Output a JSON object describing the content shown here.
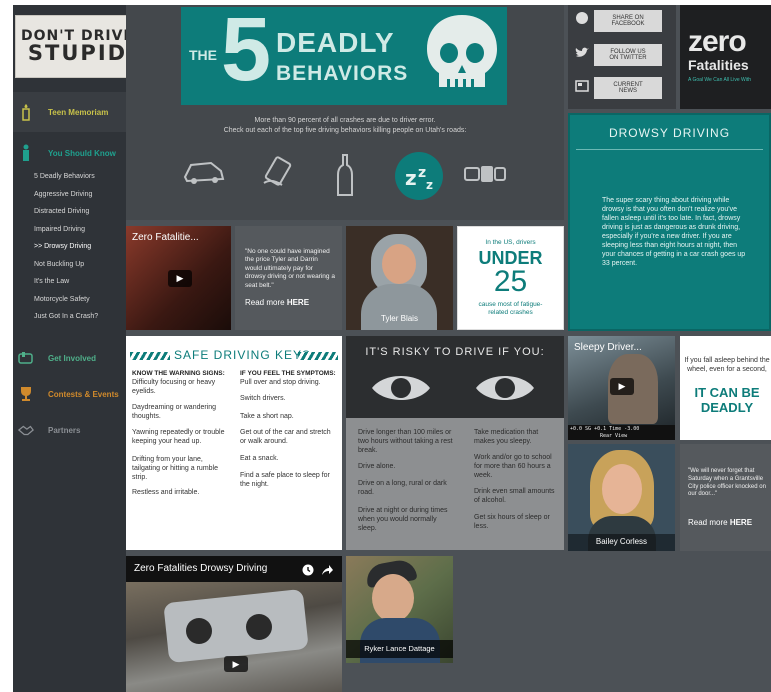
{
  "logo": {
    "line1": "DON'T DRIVE",
    "line2": "STUPID"
  },
  "nav": {
    "teen_memoriam": "Teen Memoriam",
    "you_should_know": "You Should Know",
    "sub_items": [
      "5 Deadly Behaviors",
      "Aggressive Driving",
      "Distracted Driving",
      "Impaired Driving",
      ">> Drowsy Driving",
      "Not Buckling Up",
      "It's the Law",
      "Motorcycle Safety",
      "Just Got In a Crash?"
    ],
    "get_involved": "Get Involved",
    "contests": "Contests & Events",
    "partners": "Partners"
  },
  "hero": {
    "the": "THE",
    "five": "5",
    "deadly": "DEADLY",
    "behaviors": "BEHAVIORS",
    "caption1": "More than 90 percent of all crashes are due to driver error.",
    "caption2": "Check out each of the top five driving behaviors killing people on Utah's roads:"
  },
  "social": {
    "facebook": [
      "SHARE ON",
      "FACEBOOK"
    ],
    "twitter": [
      "FOLLOW US",
      "ON TWITTER"
    ],
    "news": [
      "CURRENT",
      "NEWS"
    ]
  },
  "zero_banner": {
    "zero": "zero",
    "fatalities": "Fatalities",
    "tagline": "A Goal We Can All Live With"
  },
  "drowsy": {
    "title": "DROWSY DRIVING",
    "body": "The super scary thing about driving while drowsy is that you often don't realize you've fallen asleep until it's too late. In fact, drowsy driving is just as dangerous as drunk driving, especially if you're a new driver. If you are sleeping less than eight hours at night, then your chances of getting in a car crash goes up 33 percent."
  },
  "video1": {
    "title": "Zero Fatalitie..."
  },
  "quote1": {
    "text": "\"No one could have imagined the price Tyler and Darrin would ultimately pay for drowsy driving or not wearing a seat belt.\"",
    "more": "Read more",
    "here": "HERE"
  },
  "person1": {
    "name": "Tyler Blais"
  },
  "stat": {
    "pre": "In the US, drivers",
    "under": "UNDER",
    "num": "25",
    "post": "cause most of fatigue-related crashes"
  },
  "keys": {
    "title": "SAFE DRIVING KEYS",
    "warn_head": "KNOW THE WARNING SIGNS:",
    "warn": [
      "Difficulty focusing or heavy eyelids.",
      "Daydreaming or wandering thoughts.",
      "Yawning repeatedly or trouble keeping your head up.",
      "Drifting from your lane, tailgating or hitting a rumble strip.",
      "Restless and irritable."
    ],
    "symp_head": "IF YOU FEEL THE SYMPTOMS:",
    "symp": [
      "Pull over and stop driving.",
      "Switch drivers.",
      "Take a short nap.",
      "Get out of the car and stretch or walk around.",
      "Eat a snack.",
      "Find a safe place to sleep for the night."
    ]
  },
  "risky": {
    "title": "IT'S RISKY TO DRIVE IF YOU:",
    "left": [
      "Drive longer than 100 miles or two hours without taking a rest break.",
      "Drive alone.",
      "Drive on a long, rural or dark road.",
      "Drive at night or during times when you would normally sleep."
    ],
    "right": [
      "Take medication that makes you sleepy.",
      "Work and/or go to school for more than 60 hours a week.",
      "Drink even small amounts of alcohol.",
      "Get six hours of sleep or less."
    ]
  },
  "video2": {
    "title": "Sleepy Driver...",
    "hud": "+0.0   SG +0.1   Time   -3.00",
    "hud2": "Rear View"
  },
  "fall": {
    "pre": "If you fall asleep behind the wheel, even for a second,",
    "big": "IT CAN BE DEADLY"
  },
  "person2": {
    "name": "Bailey Corless"
  },
  "quote2": {
    "text": "\"We will never forget that Saturday when a Grantsville City police officer knocked on our door...\"",
    "more": "Read more",
    "here": "HERE"
  },
  "video3": {
    "title": "Zero Fatalities Drowsy Driving"
  },
  "person3": {
    "name": "Ryker Lance Dattage"
  },
  "colors": {
    "teal": "#0d7c7a",
    "sidebar": "#2f3338",
    "yellow": "#c8c24a",
    "green": "#4fb08a",
    "orange": "#d08a2c"
  }
}
